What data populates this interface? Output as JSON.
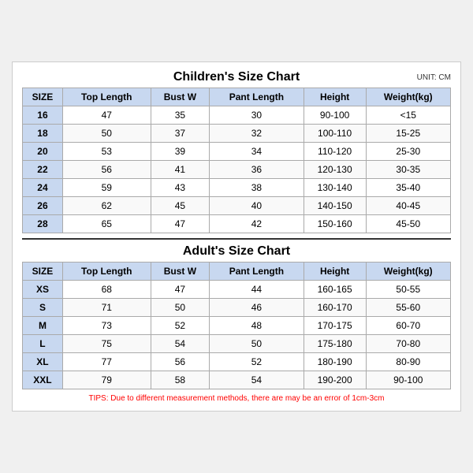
{
  "children_chart": {
    "title": "Children's Size Chart",
    "unit": "UNIT: CM",
    "headers": [
      "SIZE",
      "Top Length",
      "Bust W",
      "Pant Length",
      "Height",
      "Weight(kg)"
    ],
    "rows": [
      [
        "16",
        "47",
        "35",
        "30",
        "90-100",
        "<15"
      ],
      [
        "18",
        "50",
        "37",
        "32",
        "100-110",
        "15-25"
      ],
      [
        "20",
        "53",
        "39",
        "34",
        "110-120",
        "25-30"
      ],
      [
        "22",
        "56",
        "41",
        "36",
        "120-130",
        "30-35"
      ],
      [
        "24",
        "59",
        "43",
        "38",
        "130-140",
        "35-40"
      ],
      [
        "26",
        "62",
        "45",
        "40",
        "140-150",
        "40-45"
      ],
      [
        "28",
        "65",
        "47",
        "42",
        "150-160",
        "45-50"
      ]
    ]
  },
  "adults_chart": {
    "title": "Adult's Size Chart",
    "headers": [
      "SIZE",
      "Top Length",
      "Bust W",
      "Pant Length",
      "Height",
      "Weight(kg)"
    ],
    "rows": [
      [
        "XS",
        "68",
        "47",
        "44",
        "160-165",
        "50-55"
      ],
      [
        "S",
        "71",
        "50",
        "46",
        "160-170",
        "55-60"
      ],
      [
        "M",
        "73",
        "52",
        "48",
        "170-175",
        "60-70"
      ],
      [
        "L",
        "75",
        "54",
        "50",
        "175-180",
        "70-80"
      ],
      [
        "XL",
        "77",
        "56",
        "52",
        "180-190",
        "80-90"
      ],
      [
        "XXL",
        "79",
        "58",
        "54",
        "190-200",
        "90-100"
      ]
    ]
  },
  "tips": "TIPS: Due to different measurement methods, there are may be an error of 1cm-3cm"
}
